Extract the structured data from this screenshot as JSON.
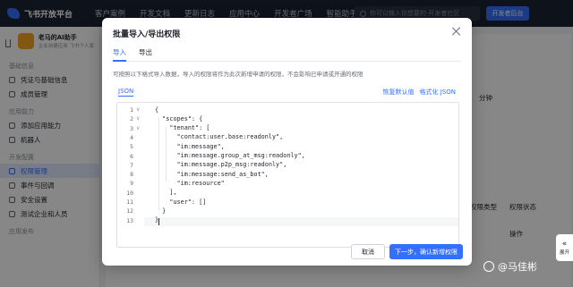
{
  "topbar": {
    "logo_text": "飞书开放平台",
    "nav": [
      "客户案例",
      "开发文档",
      "更新日志",
      "应用中心",
      "开发者广场",
      "智能助手"
    ],
    "search_placeholder": "你可以输入你想要的·开发者社区",
    "action_button": "开发者后台"
  },
  "sidebar": {
    "app_name": "老马的AI助手",
    "app_sub": "企业自建应用 飞书个人版",
    "groups": [
      {
        "title": "基础信息",
        "items": [
          "凭证与基础信息",
          "成员管理"
        ]
      },
      {
        "title": "应用能力",
        "items": [
          "添加应用能力",
          "机器人"
        ]
      },
      {
        "title": "开发配置",
        "items": [
          "权限管理",
          "事件与回调",
          "安全设置",
          "测试企业和人员"
        ]
      },
      {
        "title": "应用发布",
        "items": []
      }
    ],
    "active_item": "权限管理"
  },
  "background": {
    "right_text_1": "分钟",
    "filter_type": "权限类型",
    "filter_status": "权限状态",
    "column_action": "操作"
  },
  "modal": {
    "title": "批量导入/导出权限",
    "tabs": [
      "导入",
      "导出"
    ],
    "active_tab": "导入",
    "description": "可按照以下格式导入数据，导入的权限将作为此次新增申请的权限，不会影响已申请或开通的权限",
    "editor": {
      "mode_label": "JSON",
      "actions": [
        "恢复默认值",
        "格式化 JSON"
      ],
      "line_numbers": [
        "1",
        "2",
        "3",
        "4",
        "5",
        "6",
        "7",
        "8",
        "9",
        "10",
        "11",
        "12",
        "13"
      ],
      "lines": [
        "{",
        "  \"scopes\": {",
        "    \"tenant\": [",
        "      \"contact:user.base:readonly\",",
        "      \"im:message\",",
        "      \"im:message.group_at_msg:readonly\",",
        "      \"im:message.p2p_msg:readonly\",",
        "      \"im:message:send_as_bot\",",
        "      \"im:resource\"",
        "    ],",
        "    \"user\": []",
        "  }",
        "}"
      ]
    },
    "cancel_label": "取消",
    "confirm_label": "下一步，确认新增权限"
  },
  "floating": {
    "label": "展开"
  },
  "watermark": "@马佳彬",
  "colors": {
    "accent": "#3370ff",
    "topbar": "#1b2233",
    "overlay": "rgba(0,0,0,0.47)"
  }
}
